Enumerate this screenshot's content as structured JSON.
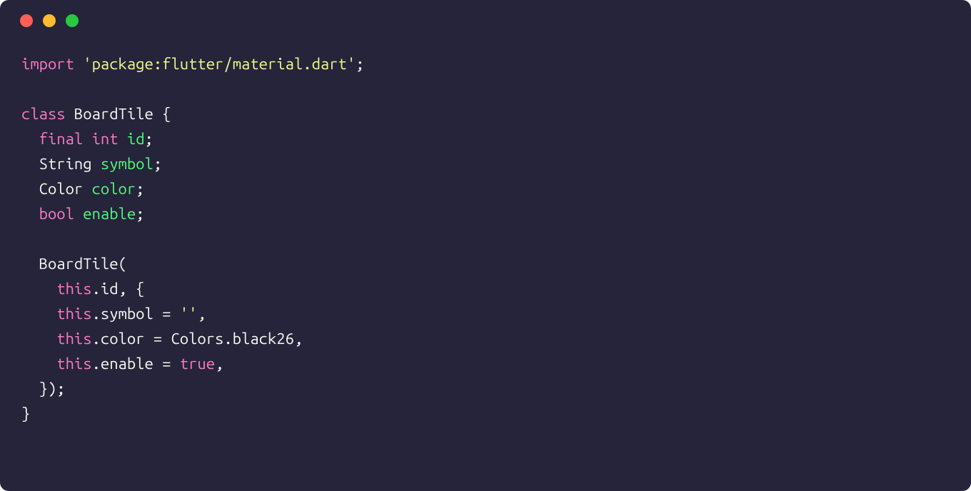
{
  "window": {
    "traffic_lights": [
      "red",
      "yellow",
      "green"
    ]
  },
  "code": {
    "language": "dart",
    "tokens": [
      [
        {
          "t": "import",
          "c": "kw"
        },
        {
          "t": " ",
          "c": "punct"
        },
        {
          "t": "'package:flutter/material.dart'",
          "c": "str"
        },
        {
          "t": ";",
          "c": "punct"
        }
      ],
      [],
      [
        {
          "t": "class",
          "c": "kw"
        },
        {
          "t": " BoardTile {",
          "c": "type"
        }
      ],
      [
        {
          "t": "  ",
          "c": "punct"
        },
        {
          "t": "final",
          "c": "kw"
        },
        {
          "t": " ",
          "c": "punct"
        },
        {
          "t": "int",
          "c": "kw"
        },
        {
          "t": " ",
          "c": "punct"
        },
        {
          "t": "id",
          "c": "ident"
        },
        {
          "t": ";",
          "c": "punct"
        }
      ],
      [
        {
          "t": "  String ",
          "c": "type"
        },
        {
          "t": "symbol",
          "c": "ident"
        },
        {
          "t": ";",
          "c": "punct"
        }
      ],
      [
        {
          "t": "  Color ",
          "c": "type"
        },
        {
          "t": "color",
          "c": "ident"
        },
        {
          "t": ";",
          "c": "punct"
        }
      ],
      [
        {
          "t": "  ",
          "c": "punct"
        },
        {
          "t": "bool",
          "c": "kw"
        },
        {
          "t": " ",
          "c": "punct"
        },
        {
          "t": "enable",
          "c": "ident"
        },
        {
          "t": ";",
          "c": "punct"
        }
      ],
      [],
      [
        {
          "t": "  BoardTile(",
          "c": "type"
        }
      ],
      [
        {
          "t": "    ",
          "c": "punct"
        },
        {
          "t": "this",
          "c": "this"
        },
        {
          "t": ".id, {",
          "c": "type"
        }
      ],
      [
        {
          "t": "    ",
          "c": "punct"
        },
        {
          "t": "this",
          "c": "this"
        },
        {
          "t": ".symbol = ",
          "c": "type"
        },
        {
          "t": "''",
          "c": "str"
        },
        {
          "t": ",",
          "c": "punct"
        }
      ],
      [
        {
          "t": "    ",
          "c": "punct"
        },
        {
          "t": "this",
          "c": "this"
        },
        {
          "t": ".color = Colors.black26,",
          "c": "type"
        }
      ],
      [
        {
          "t": "    ",
          "c": "punct"
        },
        {
          "t": "this",
          "c": "this"
        },
        {
          "t": ".enable = ",
          "c": "type"
        },
        {
          "t": "true",
          "c": "kw"
        },
        {
          "t": ",",
          "c": "punct"
        }
      ],
      [
        {
          "t": "  });",
          "c": "type"
        }
      ],
      [
        {
          "t": "}",
          "c": "type"
        }
      ]
    ]
  }
}
